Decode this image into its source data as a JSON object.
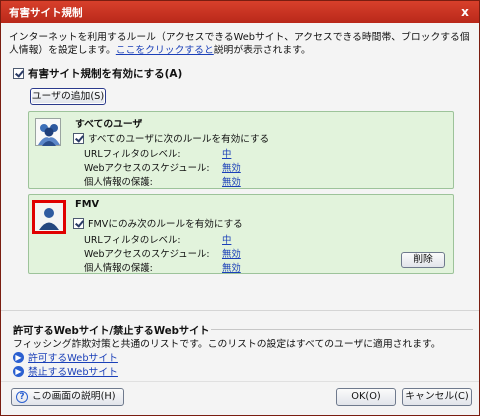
{
  "window": {
    "title": "有害サイト規制",
    "close_glyph": "x"
  },
  "description": {
    "text_before": "インターネットを利用するルール（アクセスできるWebサイト、アクセスできる時間帯、ブロックする個人情報）を設定します。",
    "link": "ここをクリックすると",
    "text_after": "説明が表示されます。"
  },
  "main_checkbox": {
    "label": "有害サイト規制を有効にする(A)",
    "checked": true
  },
  "add_user_button": "ユーザの追加(S)",
  "panels": [
    {
      "title": "すべてのユーザ",
      "checkbox_label": "すべてのユーザに次のルールを有効にする",
      "checked": true,
      "settings": [
        {
          "label": "URLフィルタのレベル:",
          "value": "中"
        },
        {
          "label": "Webアクセスのスケジュール:",
          "value": "無効"
        },
        {
          "label": "個人情報の保護:",
          "value": "無効"
        }
      ]
    },
    {
      "title": "FMV",
      "checkbox_label": "FMVにのみ次のルールを有効にする",
      "checked": true,
      "settings": [
        {
          "label": "URLフィルタのレベル:",
          "value": "中"
        },
        {
          "label": "Webアクセスのスケジュール:",
          "value": "無効"
        },
        {
          "label": "個人情報の保護:",
          "value": "無効"
        }
      ],
      "delete_button": "削除"
    }
  ],
  "sites_section": {
    "title": "許可するWebサイト/禁止するWebサイト",
    "description": "フィッシング詐欺対策と共通のリストです。このリストの設定はすべてのユーザに適用されます。",
    "links": [
      "許可するWebサイト",
      "禁止するWebサイト"
    ]
  },
  "footer": {
    "help_button": "この画面の説明(H)",
    "ok_button": "OK(O)",
    "cancel_button": "キャンセル(C)"
  },
  "colors": {
    "title_bar": "#c3301f",
    "panel_bg": "#e2f3dc",
    "link": "#1a3fb8",
    "highlight_border": "#e00000"
  }
}
